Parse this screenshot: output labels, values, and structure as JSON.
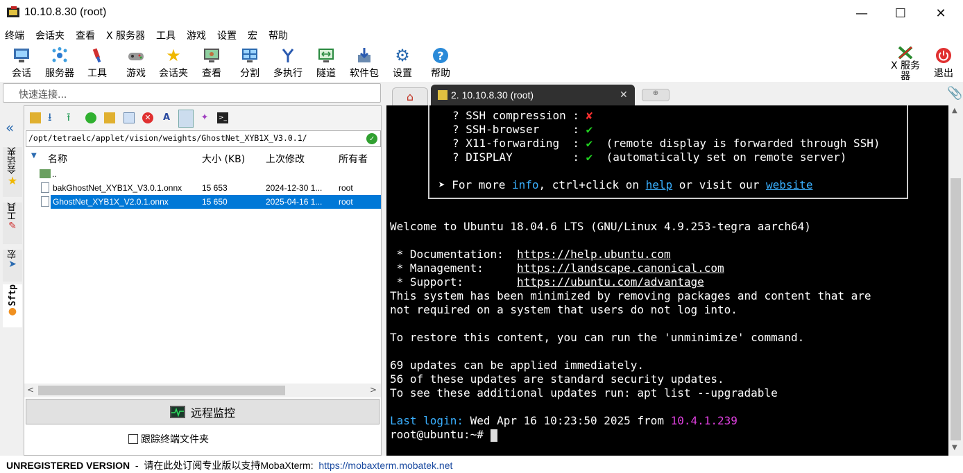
{
  "window": {
    "title": "10.10.8.30 (root)"
  },
  "menu": [
    "终端",
    "会话夹",
    "查看",
    "X 服务器",
    "工具",
    "游戏",
    "设置",
    "宏",
    "帮助"
  ],
  "toolbar": {
    "items": [
      "会话",
      "服务器",
      "工具",
      "游戏",
      "会话夹",
      "查看",
      "分割",
      "多执行",
      "隧道",
      "软件包",
      "设置",
      "帮助"
    ],
    "xserver": "X 服务器",
    "exit": "退出"
  },
  "quick_connect": {
    "placeholder": "快速连接..."
  },
  "sidebar": {
    "tabs": [
      "会话夹",
      "工具",
      "宏",
      "Sftp"
    ]
  },
  "sftp": {
    "path": "/opt/tetraelc/applet/vision/weights/GhostNet_XYB1X_V3.0.1/",
    "columns": [
      "名称",
      "大小 (KB)",
      "上次修改",
      "所有者"
    ],
    "parent": "..",
    "files": [
      {
        "name": "bakGhostNet_XYB1X_V3.0.1.onnx",
        "size": "15 653",
        "modified": "2024-12-30 1...",
        "owner": "root"
      },
      {
        "name": "GhostNet_XYB1X_V2.0.1.onnx",
        "size": "15 650",
        "modified": "2025-04-16 1...",
        "owner": "root"
      }
    ],
    "monitor_button": "远程监控",
    "follow_label": "跟踪终端文件夹"
  },
  "tabs": {
    "active": "2. 10.10.8.30 (root)"
  },
  "terminal": {
    "features": [
      {
        "name": "? SSH compression : ",
        "mark": "✘",
        "note": ""
      },
      {
        "name": "? SSH-browser     : ",
        "mark": "✔",
        "note": ""
      },
      {
        "name": "? X11-forwarding  : ",
        "mark": "✔",
        "note": "  (remote display is forwarded through SSH)"
      },
      {
        "name": "? DISPLAY         : ",
        "mark": "✔",
        "note": "  (automatically set on remote server)"
      }
    ],
    "more": {
      "prefix": "➤ For more ",
      "info": "info",
      "mid": ", ctrl+click on ",
      "help": "help",
      "mid2": " or visit our ",
      "website": "website"
    },
    "welcome": "Welcome to Ubuntu 18.04.6 LTS (GNU/Linux 4.9.253-tegra aarch64)",
    "doc_label": " * Documentation:  ",
    "doc_url": "https://help.ubuntu.com",
    "mgmt_label": " * Management:     ",
    "mgmt_url": "https://landscape.canonical.com",
    "sup_label": " * Support:        ",
    "sup_url": "https://ubuntu.com/advantage",
    "min1": "This system has been minimized by removing packages and content that are",
    "min2": "not required on a system that users do not log into.",
    "restore": "To restore this content, you can run the 'unminimize' command.",
    "upd1": "69 updates can be applied immediately.",
    "upd2": "56 of these updates are standard security updates.",
    "upd3": "To see these additional updates run: apt list --upgradable",
    "last_label": "Last login: ",
    "last_time": "Wed Apr 16 10:23:50 2025 from ",
    "last_ip": "10.4.1.239",
    "prompt": "root@ubuntu:~# "
  },
  "status": {
    "unreg": "UNREGISTERED VERSION",
    "msg": "  -  请在此处订阅专业版以支持MobaXterm:  ",
    "link": "https://mobaxterm.mobatek.net"
  }
}
